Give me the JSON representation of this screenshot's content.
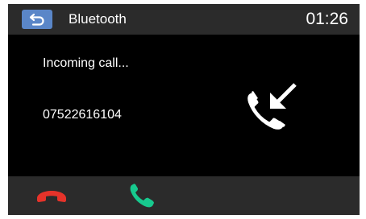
{
  "header": {
    "back_icon": "back-arrow-icon",
    "title": "Bluetooth",
    "time": "01:26"
  },
  "call": {
    "status": "Incoming call...",
    "number": "07522616104",
    "icon": "incoming-call-icon"
  },
  "footer": {
    "decline_icon": "decline-call-icon",
    "answer_icon": "answer-call-icon"
  },
  "colors": {
    "background": "#000000",
    "bars": "#2b2b2b",
    "back_button": "#5a86c8",
    "decline": "#e5332a",
    "answer": "#17c98e",
    "text": "#ffffff"
  }
}
